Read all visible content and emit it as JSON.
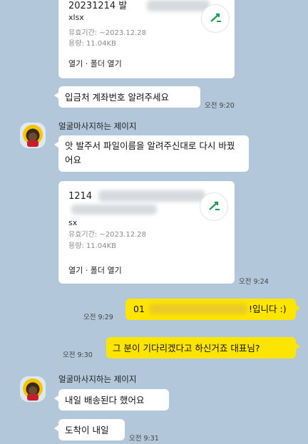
{
  "file1": {
    "name": "20231214 발",
    "ext": "xlsx",
    "expiry": "유효기간: ~2023.12.28",
    "size": "용량: 11.04KB",
    "actions": "열기 · 폴더 열기"
  },
  "msg1": {
    "text": "입금처 계좌번호 알려주세요",
    "time": "오전 9:20"
  },
  "sender": "얼굴마사지하는 제이지",
  "msg2": {
    "text": "앗 발주서 파일이름을 알려주신대로 다시 바꿨어요"
  },
  "file2": {
    "name": "1214",
    "ext": "sx",
    "expiry": "유효기간: ~2023.12.28",
    "size": "용량: 11.04KB",
    "actions": "열기 · 폴더 열기",
    "time": "오전 9:24"
  },
  "msg3": {
    "prefix": "01",
    "suffix": "!입니다 :)",
    "time": "오전 9:29"
  },
  "msg4": {
    "text": "그 분이 기다리겠다고 하신거죠 대표님?",
    "time": "오전 9:30"
  },
  "sender2": "얼굴마사지하는 제이지",
  "msg5": {
    "text": "내일 배송된다 했어요"
  },
  "msg6": {
    "text": "도착이 내일",
    "time": "오전 9:31"
  },
  "colors": {
    "background": "#b2c7da",
    "my_bubble": "#fee500",
    "their_bubble": "#ffffff"
  },
  "icons": [
    "excel-file-icon",
    "avatar-icon"
  ]
}
